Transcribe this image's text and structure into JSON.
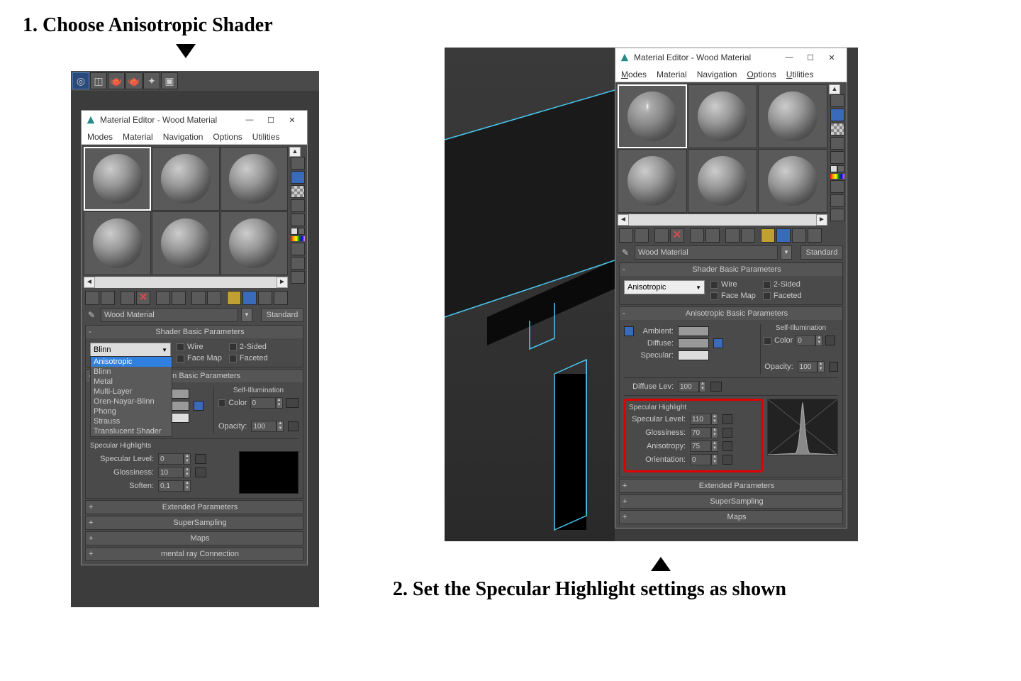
{
  "step1_heading": "1. Choose Anisotropic Shader",
  "step2_heading": "2. Set the Specular Highlight settings as shown",
  "window": {
    "title": "Material Editor - Wood Material",
    "menu": {
      "modes": "Modes",
      "material": "Material",
      "navigation": "Navigation",
      "options": "Options",
      "utilities": "Utilities"
    }
  },
  "material": {
    "name": "Wood Material",
    "type_button": "Standard"
  },
  "rollouts": {
    "shader_basic": "Shader Basic Parameters",
    "blinn_basic": "Blinn Basic Parameters",
    "aniso_basic": "Anisotropic Basic Parameters",
    "extended": "Extended Parameters",
    "supersampling": "SuperSampling",
    "maps": "Maps",
    "mental": "mental ray Connection"
  },
  "shader1": {
    "current": "Blinn",
    "options": [
      "Anisotropic",
      "Blinn",
      "Metal",
      "Multi-Layer",
      "Oren-Nayar-Blinn",
      "Phong",
      "Strauss",
      "Translucent Shader"
    ],
    "highlighted": "Anisotropic",
    "wire": "Wire",
    "two_sided": "2-Sided",
    "face_map": "Face Map",
    "faceted": "Faceted"
  },
  "shader2": {
    "current": "Anisotropic",
    "wire": "Wire",
    "two_sided": "2-Sided",
    "face_map": "Face Map",
    "faceted": "Faceted"
  },
  "labels": {
    "ambient": "Ambient:",
    "diffuse": "Diffuse:",
    "specular": "Specular:",
    "self_illum": "Self-Illumination",
    "color": "Color",
    "opacity": "Opacity:",
    "diff_lev": "Diffuse Lev:",
    "spec_hl": "Specular Highlight",
    "spec_hl_plural": "Specular Highlights",
    "spec_level": "Specular Level:",
    "glossiness": "Glossiness:",
    "anisotropy": "Anisotropy:",
    "orientation": "Orientation:",
    "soften": "Soften:"
  },
  "values1": {
    "color": "0",
    "opacity": "100",
    "spec_level": "0",
    "glossiness": "10",
    "soften": "0,1"
  },
  "values2": {
    "color": "0",
    "opacity": "100",
    "diff_lev": "100",
    "spec_level": "110",
    "glossiness": "70",
    "anisotropy": "75",
    "orientation": "0"
  }
}
